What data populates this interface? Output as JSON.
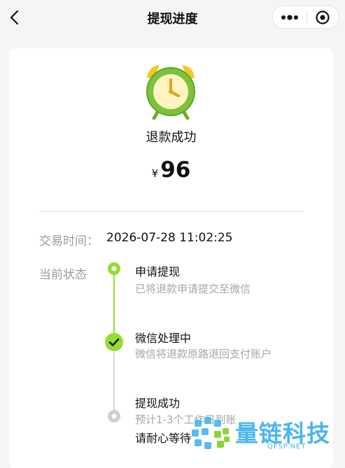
{
  "nav": {
    "title": "提现进度"
  },
  "result": {
    "icon": "alarm-clock-icon",
    "status": "退款成功",
    "currency_symbol": "¥",
    "amount": "96"
  },
  "details": {
    "time_label": "交易时间：",
    "time_value": "2026-07-28 11:02:25",
    "status_label": "当前状态"
  },
  "steps": [
    {
      "title": "申请提现",
      "desc": "已将退款申请提交至微信",
      "state": "done"
    },
    {
      "title": "微信处理中",
      "desc": "微信将退款原路退回支付账户",
      "state": "current"
    },
    {
      "title": "提现成功",
      "desc": "预计1-3个工作日到账",
      "desc2": "请耐心等待",
      "state": "pending"
    }
  ],
  "colors": {
    "accent": "#95dc31",
    "pending": "#cfcfcf",
    "watermark": "#49b6f0"
  },
  "watermark": {
    "text": "量链科技",
    "sub": "QFSP.NET"
  }
}
